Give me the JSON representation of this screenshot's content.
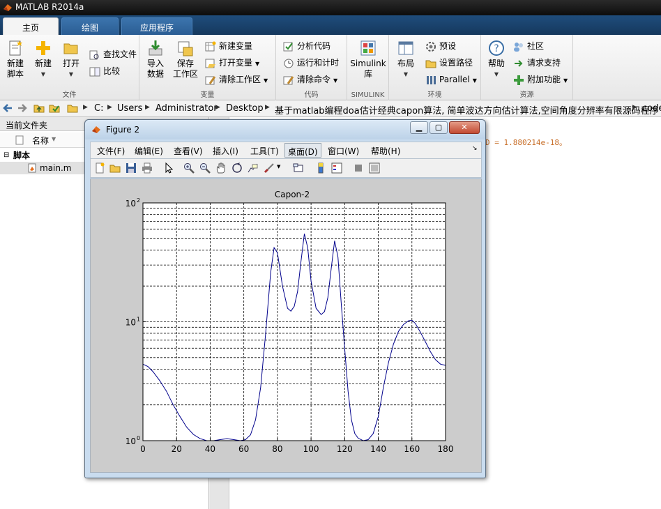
{
  "app": {
    "title": "MATLAB R2014a"
  },
  "tabs": [
    {
      "label": "主页",
      "active": true
    },
    {
      "label": "绘图",
      "active": false
    },
    {
      "label": "应用程序",
      "active": false
    }
  ],
  "ribbon": {
    "file": {
      "label": "文件",
      "new_script": "新建\n脚本",
      "new": "新建",
      "open": "打开",
      "find_files": "查找文件",
      "compare": "比较"
    },
    "variable": {
      "label": "变量",
      "import_data": "导入\n数据",
      "save_workspace": "保存\n工作区",
      "new_variable": "新建变量",
      "open_variable": "打开变量",
      "clear_workspace": "清除工作区"
    },
    "code": {
      "label": "代码",
      "analyze_code": "分析代码",
      "run_and_time": "运行和计时",
      "clear_commands": "清除命令"
    },
    "simulink": {
      "label": "SIMULINK",
      "library": "Simulink\n库"
    },
    "environment": {
      "label": "环境",
      "layout": "布局",
      "preferences": "预设",
      "set_path": "设置路径",
      "parallel": "Parallel"
    },
    "resources": {
      "label": "资源",
      "help": "帮助",
      "community": "社区",
      "request_support": "请求支持",
      "addons": "附加功能"
    }
  },
  "address": {
    "crumbs": [
      "C:",
      "Users",
      "Administrator",
      "Desktop",
      "基于matlab编程doa估计经典capon算法, 简单波达方向估计算法,空间角度分辨率有限源码程序",
      "code"
    ]
  },
  "current_folder": {
    "title": "当前文件夹",
    "column_name": "名称",
    "tree": [
      {
        "label": "脚本",
        "type": "group"
      },
      {
        "label": "main.m",
        "type": "file"
      }
    ]
  },
  "command_window": {
    "visible_text": "D =  1.880214e-18。"
  },
  "figure": {
    "title": "Figure 2",
    "menu": [
      "文件(F)",
      "编辑(E)",
      "查看(V)",
      "插入(I)",
      "工具(T)",
      "桌面(D)",
      "窗口(W)",
      "帮助(H)"
    ],
    "active_menu": "桌面(D)"
  },
  "chart_data": {
    "type": "line",
    "title": "Capon-2",
    "xlabel": "",
    "ylabel": "",
    "xlim": [
      0,
      180
    ],
    "ylim": [
      1,
      100
    ],
    "yscale": "log",
    "grid": true,
    "grid_style": "dashed",
    "xticks": [
      0,
      20,
      40,
      60,
      80,
      100,
      120,
      140,
      160,
      180
    ],
    "yticks": [
      {
        "value": 1,
        "base": "10",
        "exp": "0"
      },
      {
        "value": 10,
        "base": "10",
        "exp": "1"
      },
      {
        "value": 100,
        "base": "10",
        "exp": "2"
      }
    ],
    "line_color": "#00008b",
    "series": [
      {
        "x": [
          0,
          3,
          6,
          10,
          14,
          18,
          22,
          26,
          30,
          34,
          38,
          42,
          46,
          50,
          54,
          58,
          61,
          64,
          67,
          70,
          73,
          76,
          78,
          80,
          83,
          86,
          88,
          90,
          92,
          94,
          96,
          98,
          100,
          103,
          106,
          108,
          110,
          112,
          114,
          116,
          118,
          120,
          122,
          124,
          126,
          128,
          131,
          134,
          137,
          140,
          143,
          146,
          149,
          152,
          155,
          158,
          160,
          162,
          165,
          168,
          171,
          174,
          177,
          180
        ],
        "y": [
          4.4,
          4.2,
          3.8,
          3.2,
          2.6,
          2.0,
          1.6,
          1.3,
          1.13,
          1.04,
          1.0,
          1.0,
          1.02,
          1.04,
          1.02,
          1.0,
          1.02,
          1.12,
          1.5,
          2.8,
          8.0,
          26,
          42,
          38,
          20,
          13,
          12.3,
          13.5,
          18,
          32,
          55,
          42,
          22,
          13,
          11.5,
          12.2,
          16,
          28,
          48,
          35,
          14,
          6,
          2.6,
          1.5,
          1.15,
          1.05,
          1.0,
          1.02,
          1.15,
          1.6,
          2.8,
          4.5,
          6.5,
          8.3,
          9.5,
          10.2,
          10.3,
          9.7,
          8.2,
          6.8,
          5.6,
          4.8,
          4.4,
          4.3
        ]
      }
    ]
  }
}
